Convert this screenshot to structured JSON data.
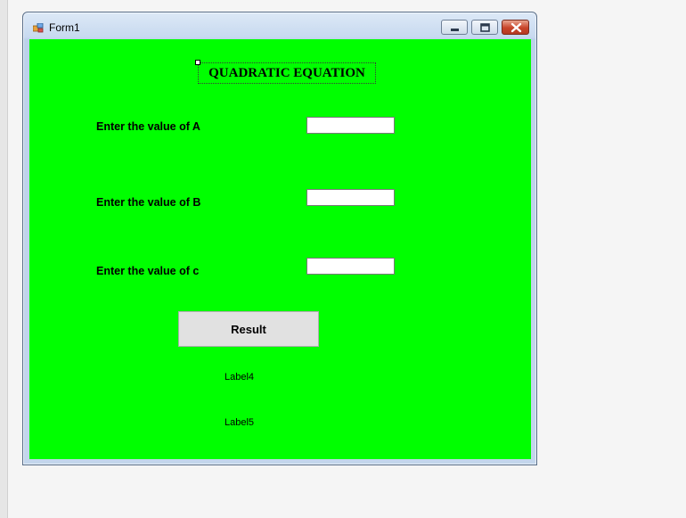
{
  "window": {
    "title": "Form1",
    "icon": "form-app-icon",
    "controls": [
      "minimize-icon",
      "maximize-icon",
      "close-icon"
    ],
    "client_color": "#00ff00"
  },
  "form": {
    "heading": "QUADRATIC EQUATION",
    "fields": [
      {
        "label": "Enter the value of A",
        "value": ""
      },
      {
        "label": "Enter the value of B",
        "value": ""
      },
      {
        "label": "Enter the value of c",
        "value": ""
      }
    ],
    "result_button": "Result",
    "label4": "Label4",
    "label5": "Label5"
  }
}
